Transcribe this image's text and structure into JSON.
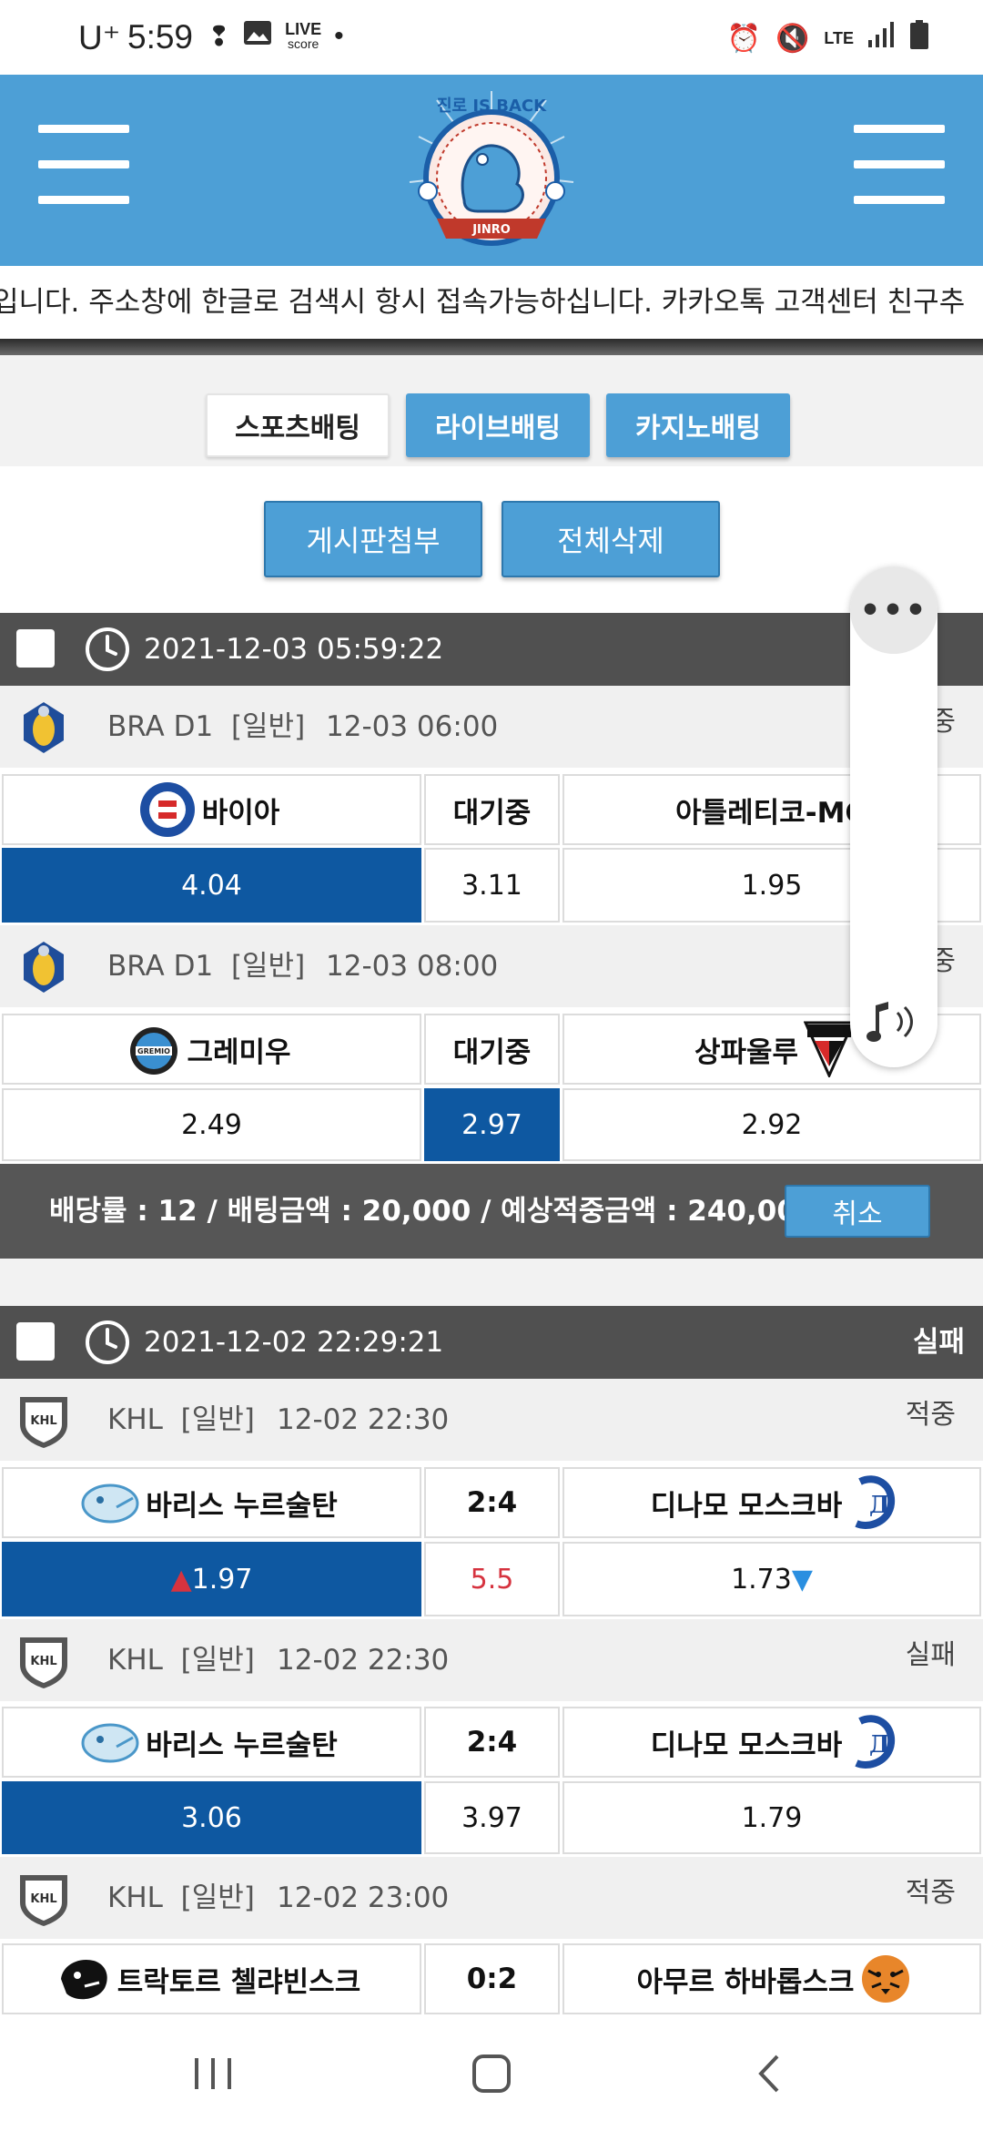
{
  "status_bar": {
    "carrier": "U⁺",
    "time": "5:59",
    "live_label": "LIVE",
    "score_label": "score",
    "network": "LTE"
  },
  "header": {
    "logo_text": "진로 IS BACK",
    "logo_sub": "JINRO",
    "brand_color": "#4d9fd6"
  },
  "ticker": {
    "text": "입니다. 주소창에 한글로 검색시 항시 접속가능하십니다. 카카오톡 고객센터 친구추"
  },
  "tabs": [
    {
      "label": "스포츠배팅",
      "active": true
    },
    {
      "label": "라이브배팅",
      "active": false
    },
    {
      "label": "카지노배팅",
      "active": false
    }
  ],
  "actions": {
    "attach_label": "게시판첨부",
    "delete_all_label": "전체삭제"
  },
  "slips": [
    {
      "date": "2021-12-03 05:59:22",
      "status": "",
      "games": [
        {
          "league": "BRA D1",
          "type": "[일반]",
          "time": "12-03 06:00",
          "result": "적중",
          "home": "바이아",
          "mid": "대기중",
          "away": "아틀레티코-MG",
          "odds": [
            "4.04",
            "3.11",
            "1.95"
          ]
        },
        {
          "league": "BRA D1",
          "type": "[일반]",
          "time": "12-03 08:00",
          "result": "적중",
          "home": "그레미우",
          "mid": "대기중",
          "away": "상파울루",
          "odds": [
            "2.49",
            "2.97",
            "2.92"
          ]
        }
      ],
      "summary": "배당률 : 12 / 배팅금액 : 20,000 / 예상적중금액 : 240,000",
      "cancel_label": "취소"
    },
    {
      "date": "2021-12-02 22:29:21",
      "status": "실패",
      "games": [
        {
          "league": "KHL",
          "type": "[일반]",
          "time": "12-02 22:30",
          "result": "적중",
          "home": "바리스 누르술탄",
          "mid": "2:4",
          "away": "디나모 모스크바",
          "odds": [
            "1.97",
            "5.5",
            "1.73"
          ]
        },
        {
          "league": "KHL",
          "type": "[일반]",
          "time": "12-02 22:30",
          "result": "실패",
          "home": "바리스 누르술탄",
          "mid": "2:4",
          "away": "디나모 모스크바",
          "odds": [
            "3.06",
            "3.97",
            "1.79"
          ]
        },
        {
          "league": "KHL",
          "type": "[일반]",
          "time": "12-02 23:00",
          "result": "적중",
          "home": "트락토르 첼랴빈스크",
          "mid": "0:2",
          "away": "아무르 하바롭스크"
        }
      ]
    }
  ],
  "float_panel": {
    "menu_label": "•••"
  },
  "colors": {
    "selected_odds": "#0e58a1",
    "header_dark": "#505050",
    "accent_red": "#d6333f"
  }
}
